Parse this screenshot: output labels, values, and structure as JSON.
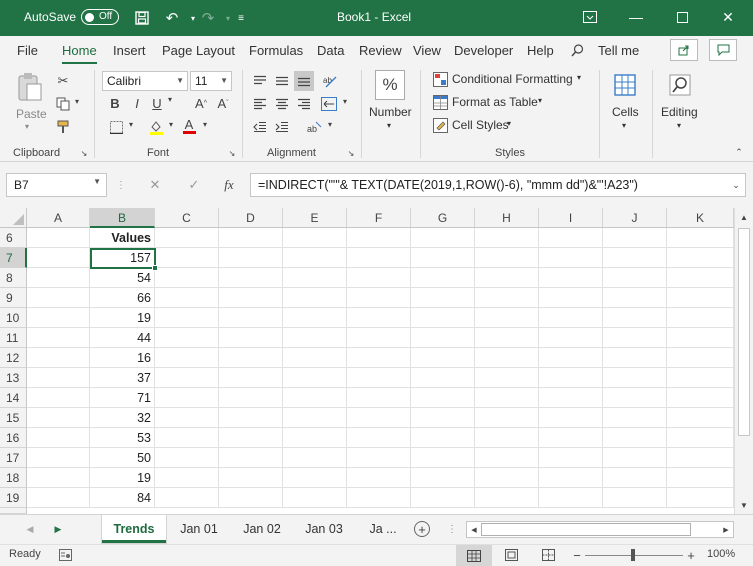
{
  "titlebar": {
    "autosave_label": "AutoSave",
    "autosave_state": "Off",
    "title": "Book1  -  Excel"
  },
  "menu": {
    "tabs": [
      "File",
      "Home",
      "Insert",
      "Page Layout",
      "Formulas",
      "Data",
      "Review",
      "View",
      "Developer",
      "Help"
    ],
    "active_tab": "Home",
    "tell_me": "Tell me"
  },
  "ribbon": {
    "clipboard": {
      "paste": "Paste",
      "label": "Clipboard"
    },
    "font": {
      "name": "Calibri",
      "size": "11",
      "label": "Font",
      "bold": "B",
      "italic": "I",
      "underline": "U"
    },
    "alignment": {
      "label": "Alignment"
    },
    "number": {
      "label": "Number"
    },
    "styles": {
      "conditional": "Conditional Formatting",
      "table": "Format as Table",
      "cell_styles": "Cell Styles",
      "label": "Styles"
    },
    "cells": {
      "label": "Cells"
    },
    "editing": {
      "label": "Editing"
    }
  },
  "formula_bar": {
    "name_box": "B7",
    "formula": "=INDIRECT(\"'\"& TEXT(DATE(2019,1,ROW()-6), \"mmm dd\")&\"'!A23\")"
  },
  "grid": {
    "columns": [
      "A",
      "B",
      "C",
      "D",
      "E",
      "F",
      "G",
      "H",
      "I",
      "J",
      "K"
    ],
    "selected_column": "B",
    "rows": [
      "6",
      "7",
      "8",
      "9",
      "10",
      "11",
      "12",
      "13",
      "14",
      "15",
      "16",
      "17",
      "18",
      "19"
    ],
    "selected_row": "7",
    "header_cell": "Values",
    "values": [
      "157",
      "54",
      "66",
      "19",
      "44",
      "16",
      "37",
      "71",
      "32",
      "53",
      "50",
      "19",
      "84"
    ]
  },
  "sheets": {
    "tabs": [
      "Trends",
      "Jan 01",
      "Jan 02",
      "Jan 03",
      "Ja ..."
    ],
    "active": "Trends"
  },
  "status": {
    "ready": "Ready",
    "zoom": "100%"
  },
  "colors": {
    "brand": "#217346",
    "ribbon_bg": "#f3f3f3",
    "selection": "#217346"
  }
}
